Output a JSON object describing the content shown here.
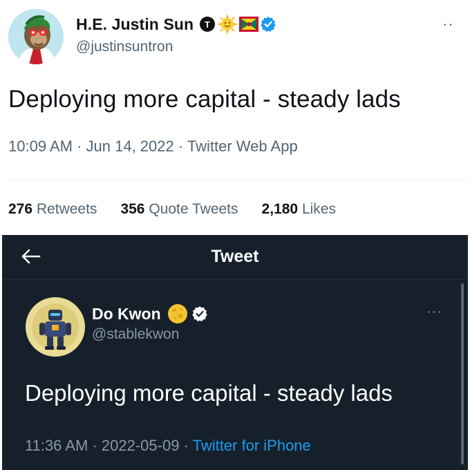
{
  "top_tweet": {
    "display_name": "H.E. Justin Sun",
    "handle": "@justinsuntron",
    "text": "Deploying more capital - steady lads",
    "time": "10:09 AM",
    "date": "Jun 14, 2022",
    "source": "Twitter Web App",
    "separator": " · ",
    "stats": [
      {
        "count": "276",
        "label": "Retweets"
      },
      {
        "count": "356",
        "label": "Quote Tweets"
      },
      {
        "count": "2,180",
        "label": "Likes"
      }
    ],
    "more": "··",
    "icons": [
      "tron-logo-icon",
      "sun-emoji-icon",
      "grenada-flag-icon",
      "verified-badge-icon"
    ]
  },
  "dark_tweet": {
    "header_title": "Tweet",
    "display_name": "Do Kwon",
    "handle": "@stablekwon",
    "text": "Deploying more capital - steady lads",
    "time": "11:36 AM",
    "date": "2022-05-09",
    "source": "Twitter for iPhone",
    "separator": " · ",
    "more": "···",
    "icons": [
      "back-arrow-icon",
      "moon-emoji-icon",
      "verified-badge-icon"
    ]
  },
  "colors": {
    "verified_blue": "#1d9bf0",
    "dark_bg": "#15202b",
    "muted_light": "#536471",
    "muted_dark": "#8b98a5"
  }
}
